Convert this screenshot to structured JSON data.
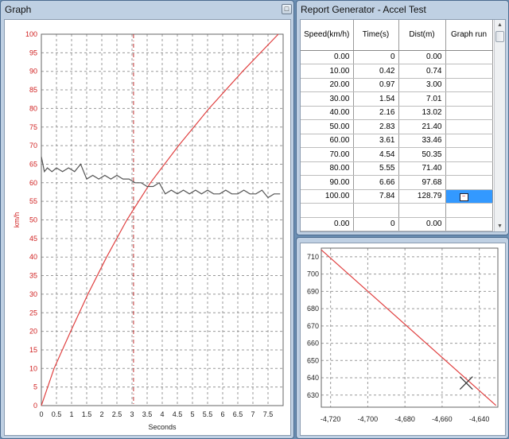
{
  "graph_window": {
    "title": "Graph",
    "maximize_glyph": "□"
  },
  "report_window": {
    "title": "Report Generator - Accel Test",
    "columns": [
      "Speed(km/h)",
      "Time(s)",
      "Dist(m)",
      "Graph run"
    ],
    "rows": [
      [
        "0.00",
        "0",
        "0.00",
        ""
      ],
      [
        "10.00",
        "0.42",
        "0.74",
        ""
      ],
      [
        "20.00",
        "0.97",
        "3.00",
        ""
      ],
      [
        "30.00",
        "1.54",
        "7.01",
        ""
      ],
      [
        "40.00",
        "2.16",
        "13.02",
        ""
      ],
      [
        "50.00",
        "2.83",
        "21.40",
        ""
      ],
      [
        "60.00",
        "3.61",
        "33.46",
        ""
      ],
      [
        "70.00",
        "4.54",
        "50.35",
        ""
      ],
      [
        "80.00",
        "5.55",
        "71.40",
        ""
      ],
      [
        "90.00",
        "6.66",
        "97.68",
        ""
      ],
      [
        "100.00",
        "7.84",
        "128.79",
        ""
      ],
      [
        "",
        "",
        "",
        ""
      ],
      [
        "0.00",
        "0",
        "0.00",
        ""
      ]
    ],
    "highlight_color": "#3399ff"
  },
  "chart_data": [
    {
      "type": "line",
      "title": "",
      "xlabel": "Seconds",
      "ylabel": "km/h",
      "xlim": [
        0,
        8
      ],
      "ylim": [
        0,
        100
      ],
      "xticks": [
        "0",
        "0.5",
        "1",
        "1.5",
        "2",
        "2.5",
        "3",
        "3.5",
        "4",
        "4.5",
        "5",
        "5.5",
        "6",
        "6.5",
        "7",
        "7.5"
      ],
      "yticks": [
        "0",
        "5",
        "10",
        "15",
        "20",
        "25",
        "30",
        "35",
        "40",
        "45",
        "50",
        "55",
        "60",
        "65",
        "70",
        "75",
        "80",
        "85",
        "90",
        "95",
        "100"
      ],
      "grid": true,
      "cursor_x": 3.05,
      "series": [
        {
          "color": "#e04040",
          "x": [
            0,
            0.42,
            0.97,
            1.54,
            2.16,
            2.83,
            3.61,
            4.54,
            5.55,
            6.66,
            7.84
          ],
          "y": [
            0,
            10,
            20,
            30,
            40,
            50,
            60,
            70,
            80,
            90,
            100
          ]
        },
        {
          "color": "#555555",
          "x": [
            0,
            0.1,
            0.2,
            0.35,
            0.5,
            0.7,
            0.9,
            1.1,
            1.3,
            1.5,
            1.7,
            1.9,
            2.1,
            2.3,
            2.5,
            2.7,
            2.9,
            3.1,
            3.3,
            3.5,
            3.7,
            3.9,
            4.1,
            4.3,
            4.5,
            4.7,
            4.9,
            5.1,
            5.3,
            5.5,
            5.7,
            5.9,
            6.1,
            6.3,
            6.5,
            6.7,
            6.9,
            7.1,
            7.3,
            7.5,
            7.7,
            7.9
          ],
          "y": [
            67,
            63,
            64,
            63,
            64,
            63,
            64,
            63,
            65,
            61,
            62,
            61,
            62,
            61,
            62,
            61,
            61,
            60,
            60,
            59,
            59,
            60,
            57,
            58,
            57,
            58,
            57,
            58,
            57,
            58,
            57,
            57,
            58,
            57,
            57,
            58,
            57,
            57,
            58,
            56,
            57,
            57
          ]
        }
      ]
    },
    {
      "type": "line",
      "title": "",
      "xlabel": "",
      "ylabel": "",
      "xlim": [
        -4725,
        -4630
      ],
      "ylim": [
        623,
        715
      ],
      "xticks": [
        "-4,720",
        "-4,700",
        "-4,680",
        "-4,660",
        "-4,640"
      ],
      "yticks": [
        "630",
        "640",
        "650",
        "660",
        "670",
        "680",
        "690",
        "700",
        "710"
      ],
      "grid": true,
      "series": [
        {
          "color": "#e04040",
          "x": [
            -4725,
            -4631
          ],
          "y": [
            714,
            624
          ]
        }
      ],
      "marker": {
        "x": -4647,
        "y": 637,
        "shape": "x"
      }
    }
  ]
}
